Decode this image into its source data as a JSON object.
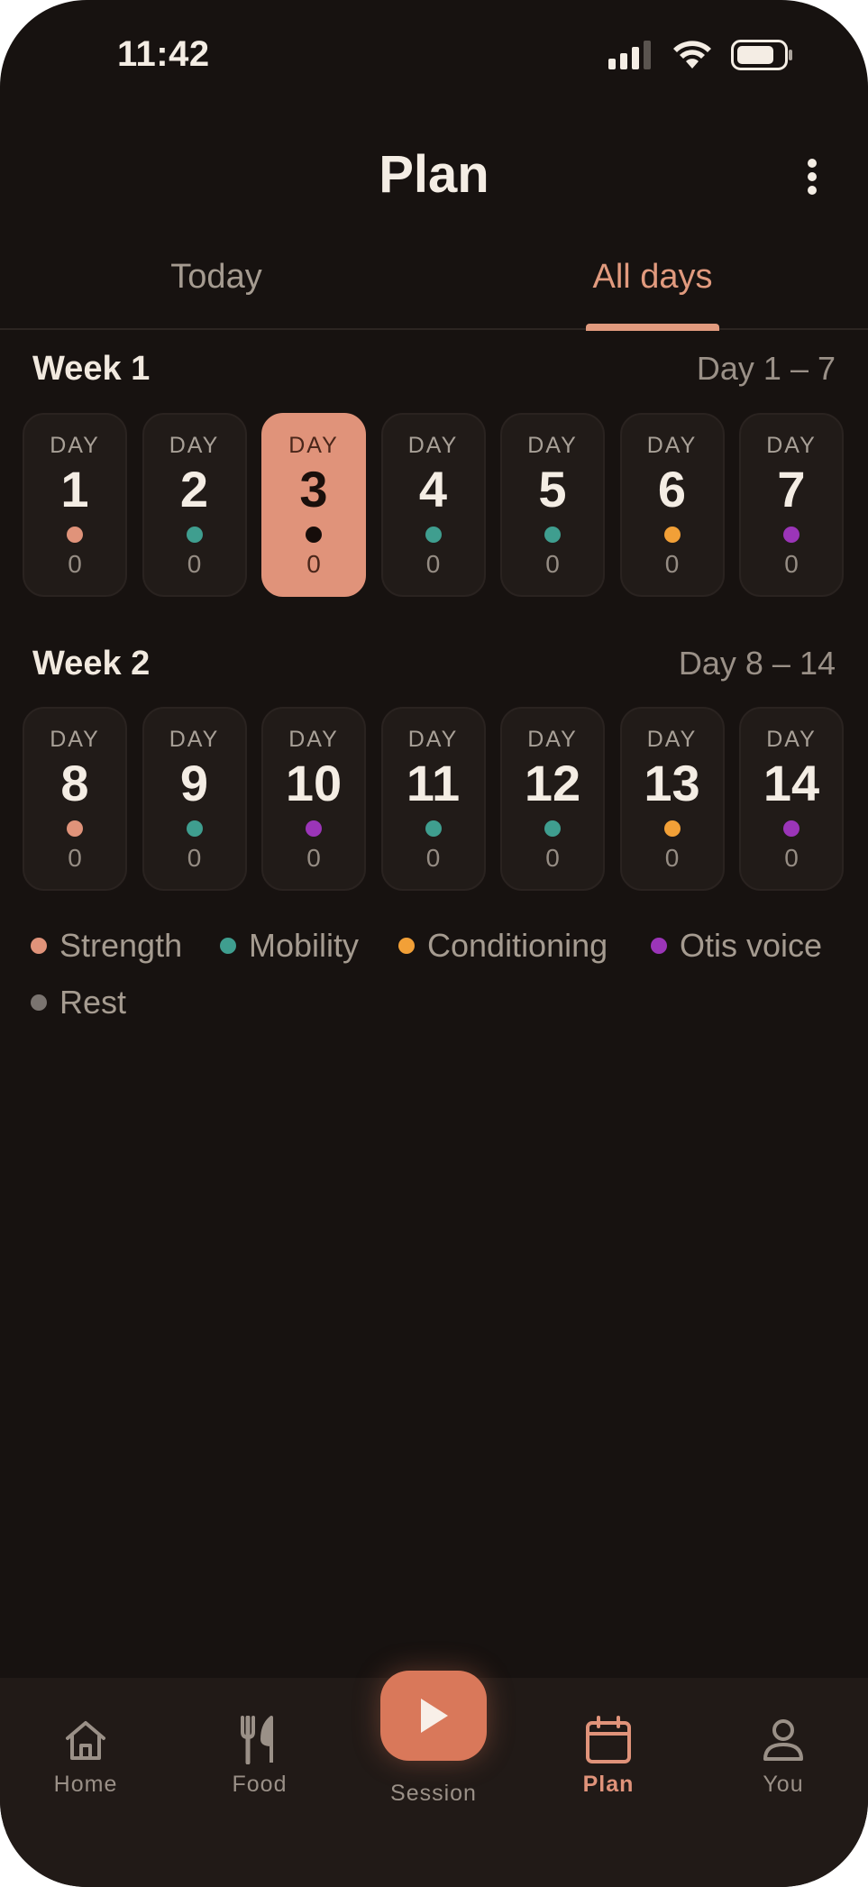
{
  "status_bar": {
    "time": "11:42"
  },
  "header": {
    "title": "Plan"
  },
  "tabs": [
    {
      "label": "Today",
      "active": false
    },
    {
      "label": "All days",
      "active": true
    }
  ],
  "colors": {
    "accent": "#e0937a",
    "strength": "#e0937a",
    "mobility": "#3f9e8f",
    "conditioning": "#f2a037",
    "otis_voice": "#9b35b8",
    "rest": "#7a7470",
    "selected_dot": "#160d0a"
  },
  "day_label": "DAY",
  "weeks": [
    {
      "title": "Week 1",
      "range": "Day 1 – 7",
      "days": [
        {
          "num": "1",
          "type": "strength",
          "count": "0"
        },
        {
          "num": "2",
          "type": "mobility",
          "count": "0"
        },
        {
          "num": "3",
          "type": "selected",
          "count": "0",
          "selected": true
        },
        {
          "num": "4",
          "type": "mobility",
          "count": "0"
        },
        {
          "num": "5",
          "type": "mobility",
          "count": "0"
        },
        {
          "num": "6",
          "type": "conditioning",
          "count": "0"
        },
        {
          "num": "7",
          "type": "otis_voice",
          "count": "0"
        }
      ]
    },
    {
      "title": "Week 2",
      "range": "Day 8 – 14",
      "days": [
        {
          "num": "8",
          "type": "strength",
          "count": "0"
        },
        {
          "num": "9",
          "type": "mobility",
          "count": "0"
        },
        {
          "num": "10",
          "type": "otis_voice",
          "count": "0"
        },
        {
          "num": "11",
          "type": "mobility",
          "count": "0"
        },
        {
          "num": "12",
          "type": "mobility",
          "count": "0"
        },
        {
          "num": "13",
          "type": "conditioning",
          "count": "0"
        },
        {
          "num": "14",
          "type": "otis_voice",
          "count": "0"
        }
      ]
    }
  ],
  "legend": [
    {
      "label": "Strength",
      "type": "strength"
    },
    {
      "label": "Mobility",
      "type": "mobility"
    },
    {
      "label": "Conditioning",
      "type": "conditioning"
    },
    {
      "label": "Otis voice",
      "type": "otis_voice"
    },
    {
      "label": "Rest",
      "type": "rest"
    }
  ],
  "bottom_nav": {
    "home": "Home",
    "food": "Food",
    "session": "Session",
    "plan": "Plan",
    "you": "You",
    "active": "plan"
  }
}
